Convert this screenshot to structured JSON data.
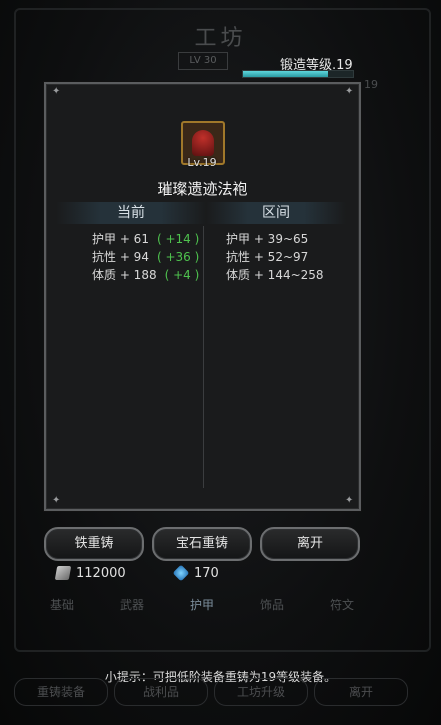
{
  "background": {
    "title": "工坊",
    "level_badge": "LV 30",
    "forge_label": "锻造等级.19",
    "forge_progress": 0.77,
    "side_number": "19",
    "tabs": [
      "基础",
      "武器",
      "护甲",
      "饰品",
      "符文"
    ]
  },
  "dialog": {
    "item_level": "Lv.19",
    "item_name": "璀璨遗迹法袍",
    "current_header": "当前",
    "range_header": "区间",
    "current_stats": [
      {
        "label": "护甲 + 61",
        "delta": "( +14 )"
      },
      {
        "label": "抗性 + 94",
        "delta": "( +36 )"
      },
      {
        "label": "体质 + 188",
        "delta": "( +4 )"
      }
    ],
    "range_stats": [
      "护甲 + 39~65",
      "抗性 + 52~97",
      "体质 + 144~258"
    ]
  },
  "buttons": {
    "iron_recast": "铁重铸",
    "gem_recast": "宝石重铸",
    "leave": "离开"
  },
  "currency": {
    "iron": "112000",
    "gem": "170"
  },
  "tip": "小提示：可把低阶装备重铸为19等级装备。",
  "bottom_nav": [
    "重铸装备",
    "战利品",
    "工坊升级",
    "离开"
  ]
}
